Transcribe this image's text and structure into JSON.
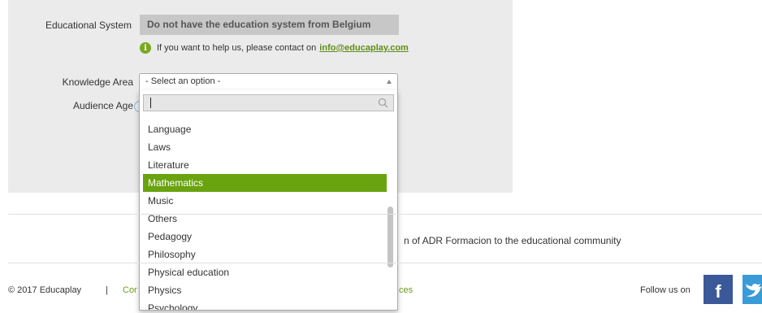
{
  "form": {
    "educational_system_label": "Educational System",
    "educational_system_value": "Do not have the education system from Belgium",
    "info_text": "If you want to help us, please contact on",
    "info_link": "info@educaplay.com",
    "info_icon": "info-icon",
    "knowledge_area_label": "Knowledge Area",
    "knowledge_area_value": "- Select an option -",
    "audience_age_label": "Audience Age"
  },
  "dropdown": {
    "search_value": "",
    "search_icon": "magnifier-icon",
    "options": [
      "Language",
      "Laws",
      "Literature",
      "Mathematics",
      "Music",
      "Others",
      "Pedagogy",
      "Philosophy",
      "Physical education",
      "Physics",
      "Psychology"
    ],
    "highlighted": "Mathematics"
  },
  "footer": {
    "tagline": "n of ADR Formacion to the educational community",
    "copyright": "© 2017 Educaplay",
    "separator": "|",
    "link_fragment_left": "Cor",
    "link_fragment_right": "ces",
    "follow_label": "Follow us on",
    "facebook_glyph": "f"
  },
  "colors": {
    "accent_green": "#69a30f",
    "link_green": "#5f8c16",
    "panel_gray": "#ebebeb",
    "facebook_blue": "#3b5998",
    "twitter_blue": "#3a9bd9"
  }
}
